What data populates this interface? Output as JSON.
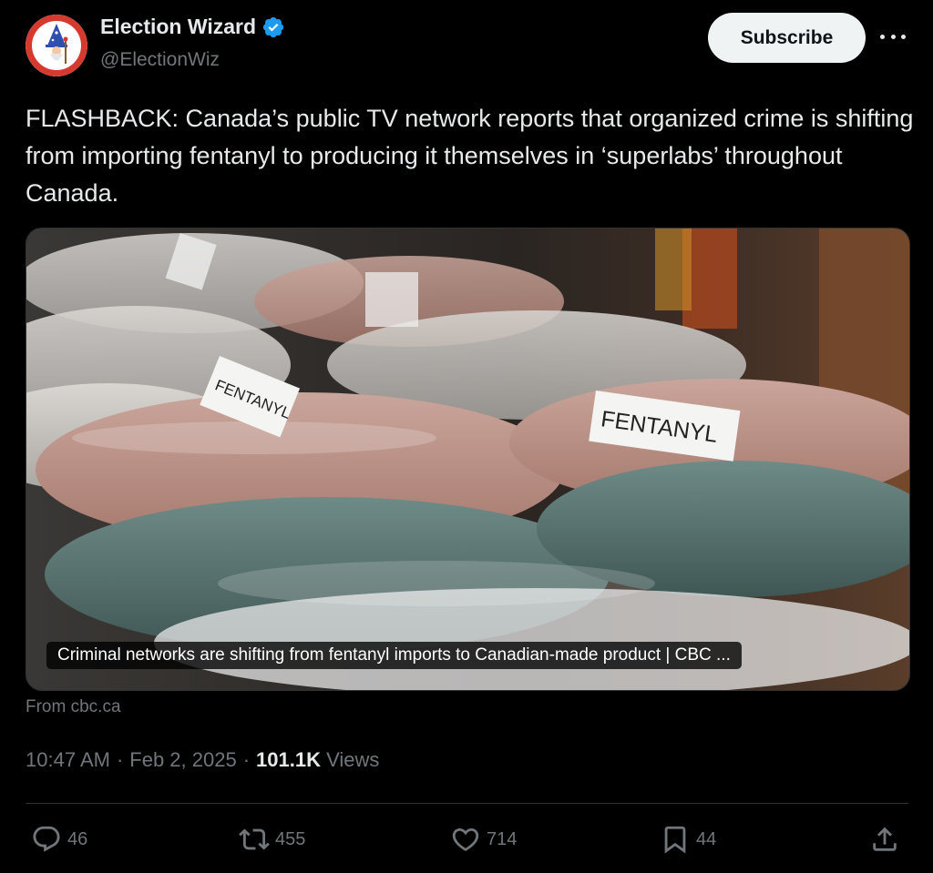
{
  "author": {
    "display_name": "Election Wizard",
    "handle": "@ElectionWiz",
    "verified": true,
    "avatar_icon": "wizard-avatar-icon"
  },
  "header": {
    "subscribe_label": "Subscribe",
    "more_icon": "more-icon"
  },
  "tweet": {
    "text": "FLASHBACK: Canada’s public TV network reports that organized crime is shifting from importing fentanyl to producing it themselves in ‘superlabs’ throughout Canada."
  },
  "media": {
    "caption": "Criminal networks are shifting from fentanyl imports to Canadian-made product | CBC ...",
    "photo_labels": [
      "FENTANYL",
      "FENTANYL"
    ],
    "source": "From cbc.ca"
  },
  "meta": {
    "time": "10:47 AM",
    "separator": "·",
    "date": "Feb 2, 2025",
    "views_count": "101.1K",
    "views_label": "Views"
  },
  "actions": {
    "replies": "46",
    "reposts": "455",
    "likes": "714",
    "bookmarks": "44"
  },
  "colors": {
    "background": "#000000",
    "text": "#e7e9ea",
    "muted": "#71767b",
    "verified": "#1d9bf0",
    "subscribe_bg": "#eff3f4"
  }
}
